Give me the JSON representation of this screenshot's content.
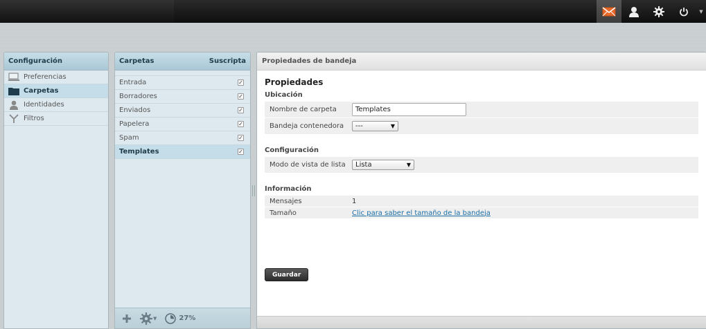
{
  "nav": {
    "title": "Configuración",
    "items": [
      {
        "label": "Preferencias",
        "icon": "monitor-icon"
      },
      {
        "label": "Carpetas",
        "icon": "folder-icon",
        "selected": true
      },
      {
        "label": "Identidades",
        "icon": "user-icon"
      },
      {
        "label": "Filtros",
        "icon": "filter-icon"
      }
    ]
  },
  "folders": {
    "title": "Carpetas",
    "subscribed_label": "Suscripta",
    "items": [
      {
        "label": "Entrada",
        "subscribed": true
      },
      {
        "label": "Borradores",
        "subscribed": true
      },
      {
        "label": "Enviados",
        "subscribed": true
      },
      {
        "label": "Papelera",
        "subscribed": true
      },
      {
        "label": "Spam",
        "subscribed": true
      },
      {
        "label": "Templates",
        "subscribed": true,
        "selected": true
      }
    ],
    "quota": "27%",
    "quota_fraction": 0.27
  },
  "props": {
    "header": "Propiedades de bandeja",
    "title": "Propiedades",
    "location": {
      "title": "Ubicación",
      "folder_name_label": "Nombre de carpeta",
      "folder_name_value": "Templates",
      "parent_label": "Bandeja contenedora",
      "parent_value": "---"
    },
    "settings": {
      "title": "Configuración",
      "list_view_label": "Modo de vista de lista",
      "list_view_value": "Lista"
    },
    "info": {
      "title": "Información",
      "messages_label": "Mensajes",
      "messages_value": "1",
      "size_label": "Tamaño",
      "size_link": "Clic para saber el tamaño de la bandeja"
    },
    "save_label": "Guardar"
  },
  "colors": {
    "accent": "#1a6fa6",
    "mail_active": "#e8692a"
  }
}
